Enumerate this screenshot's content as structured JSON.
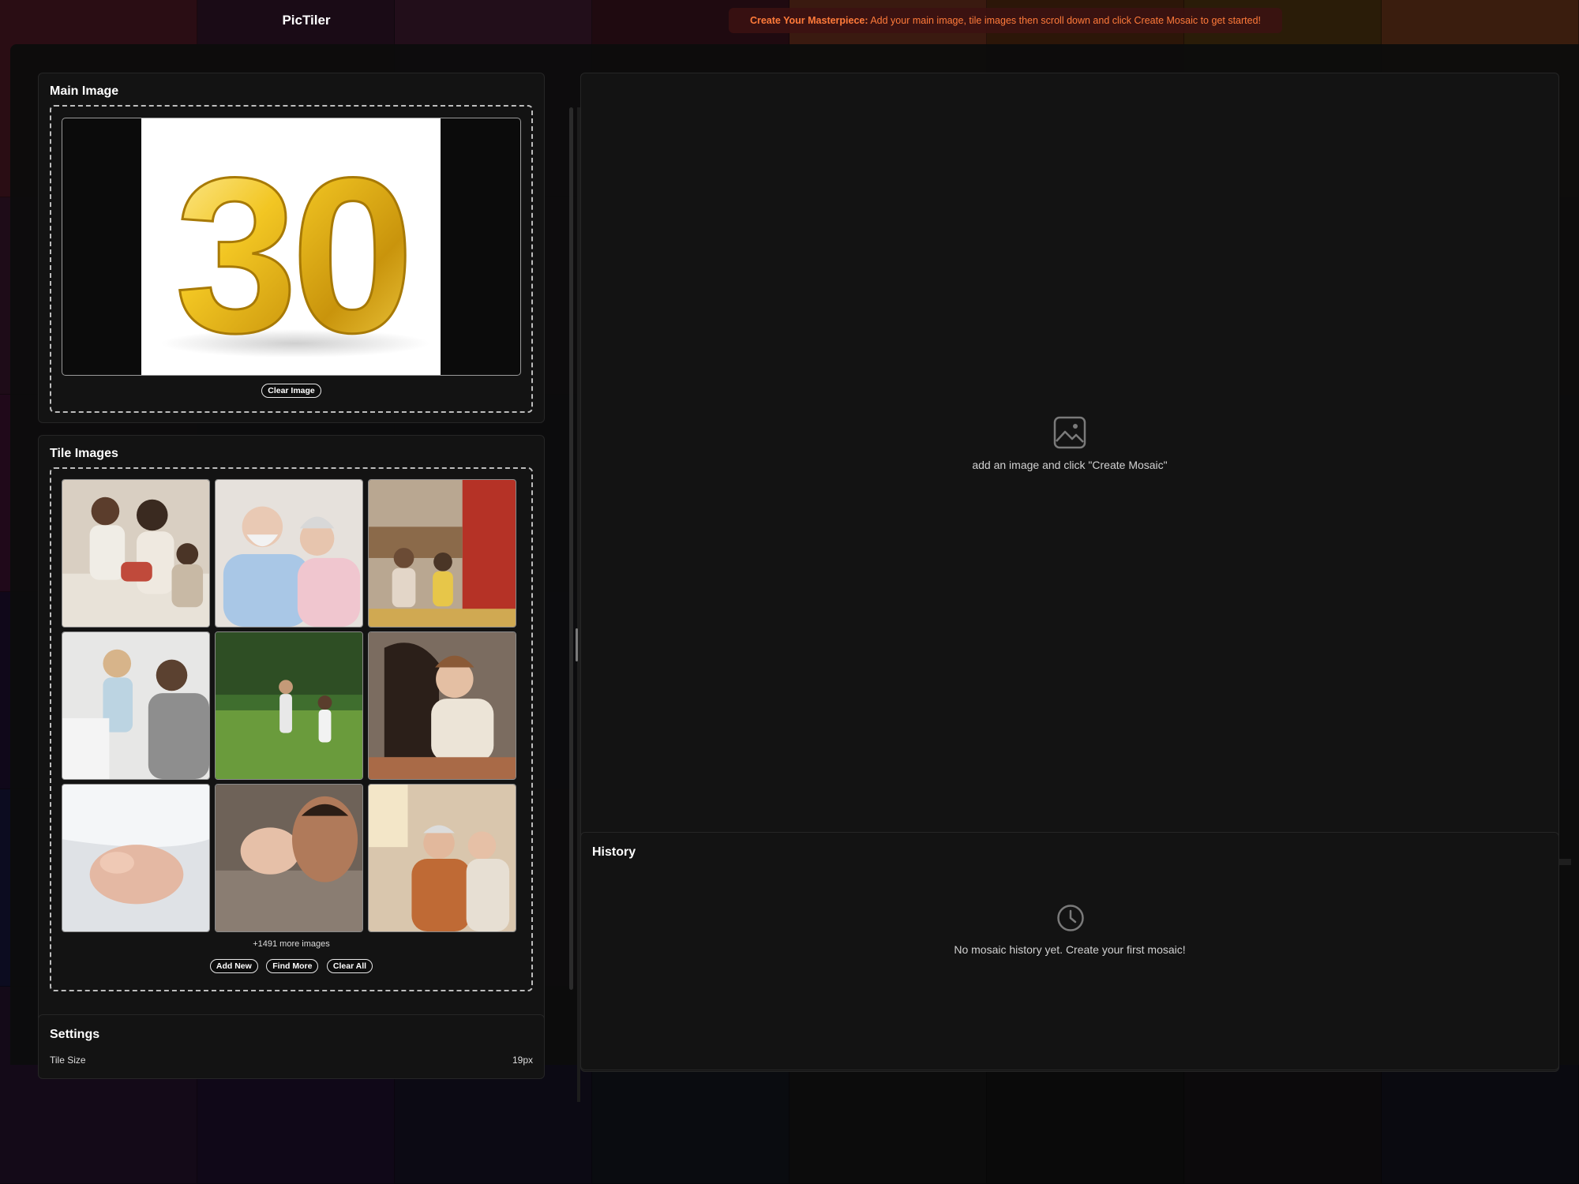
{
  "app": {
    "title": "PicTiler"
  },
  "banner": {
    "strong": "Create Your Masterpiece:",
    "text": " Add your main image, tile images then scroll down and click Create Mosaic to get started!"
  },
  "main_image": {
    "title": "Main Image",
    "preview_text": "30",
    "clear_label": "Clear Image"
  },
  "tile_images": {
    "title": "Tile Images",
    "more_text": "+1491 more images",
    "buttons": {
      "add": "Add New",
      "find": "Find More",
      "clear": "Clear All"
    }
  },
  "settings": {
    "title": "Settings",
    "tile_size_label": "Tile Size",
    "tile_size_value": "19px"
  },
  "preview": {
    "empty_text": "add an image and click \"Create Mosaic\"",
    "icon": "image-icon"
  },
  "history": {
    "title": "History",
    "empty_text": "No mosaic history yet. Create your first mosaic!",
    "icon": "clock-icon"
  },
  "colors": {
    "accent": "#ff7b3a",
    "gold": "#e8b81c"
  }
}
